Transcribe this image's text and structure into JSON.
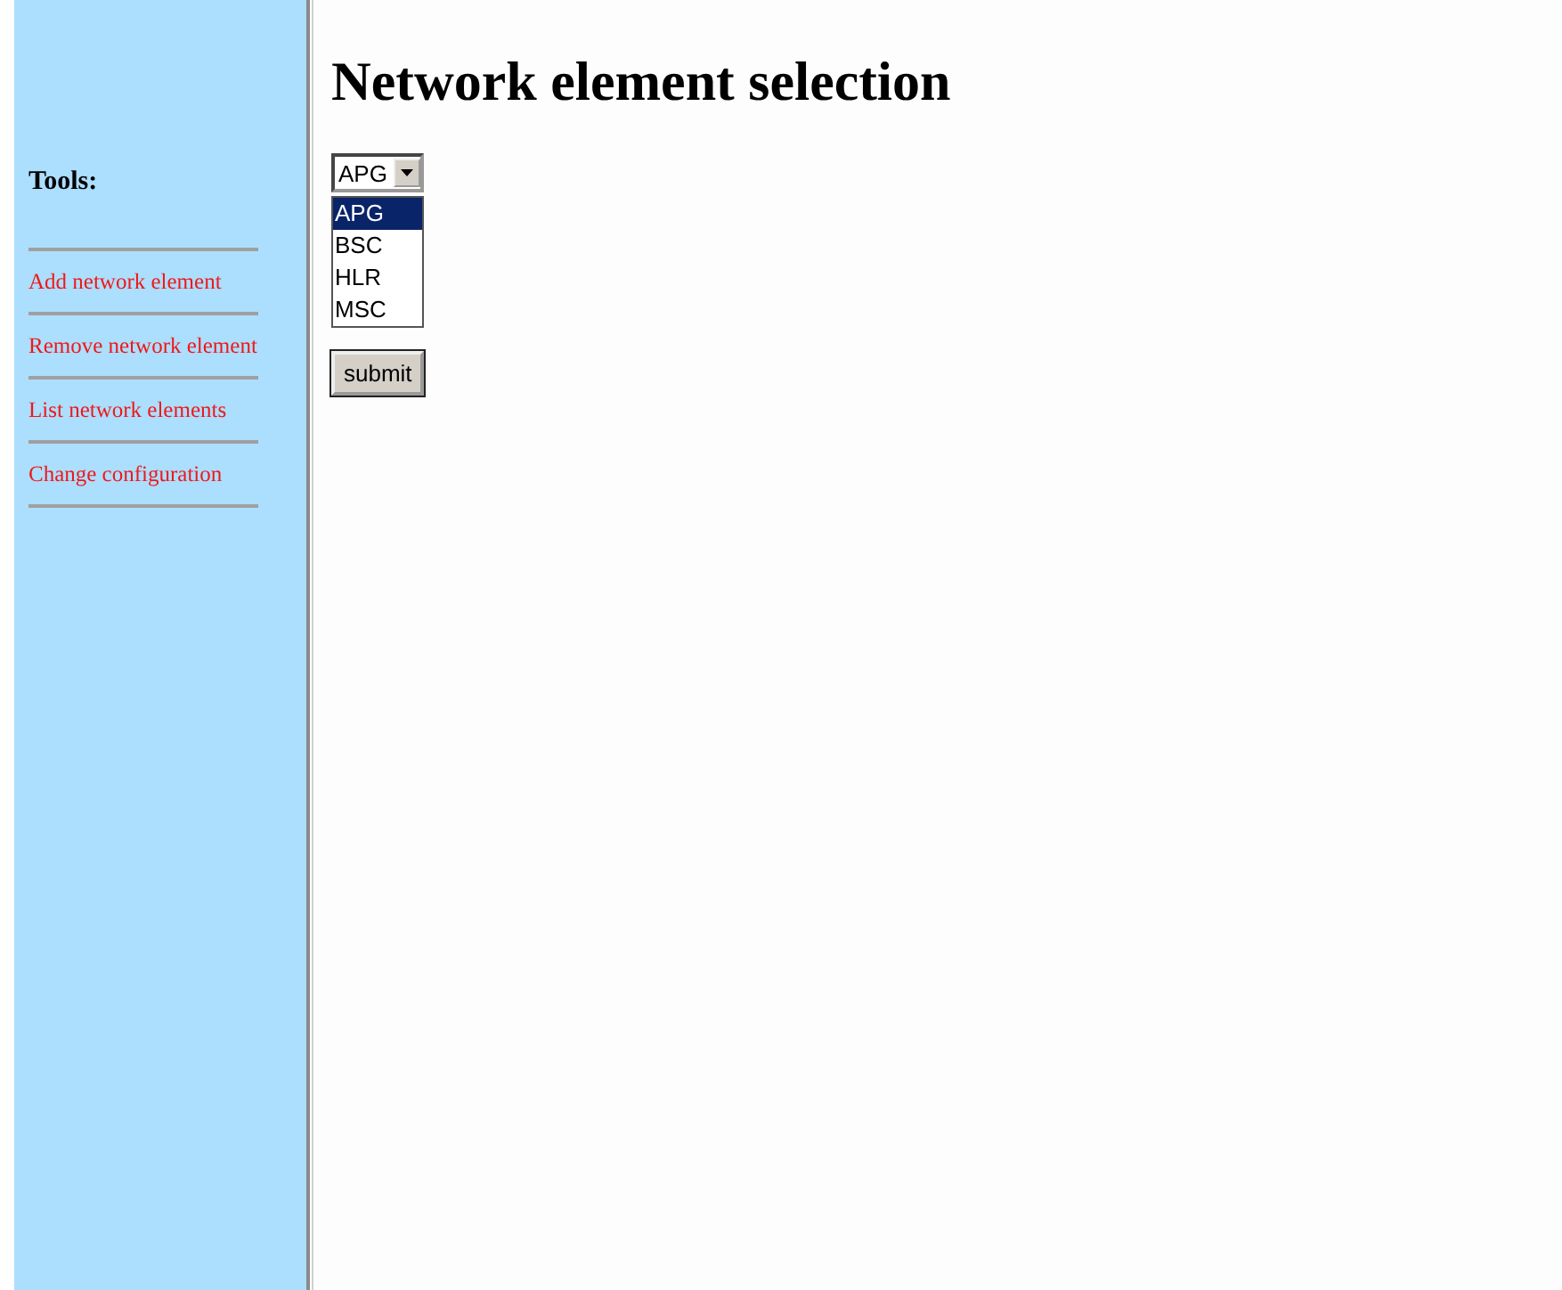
{
  "sidebar": {
    "title": "Tools:",
    "links": [
      {
        "label": "Add network element"
      },
      {
        "label": "Remove network element"
      },
      {
        "label": "List network elements"
      },
      {
        "label": "Change configuration"
      }
    ]
  },
  "main": {
    "heading": "Network element selection",
    "select": {
      "value": "APG",
      "options": [
        {
          "label": "APG",
          "selected": true
        },
        {
          "label": "BSC",
          "selected": false
        },
        {
          "label": "HLR",
          "selected": false
        },
        {
          "label": "MSC",
          "selected": false
        }
      ]
    },
    "submit": "submit"
  }
}
